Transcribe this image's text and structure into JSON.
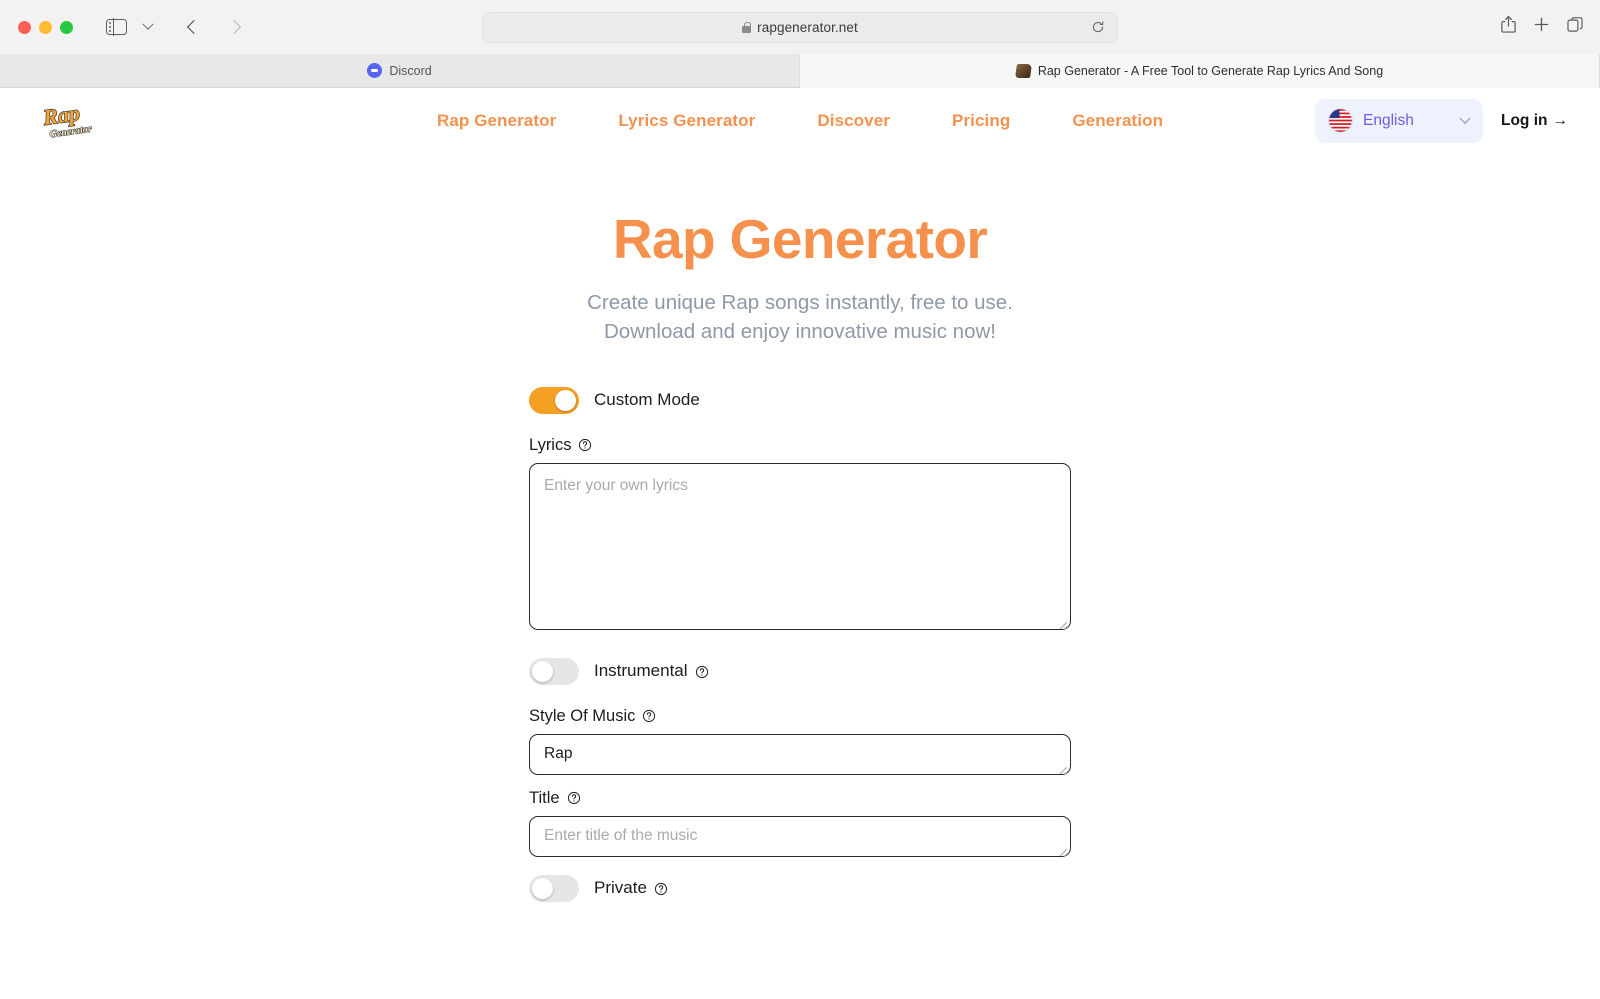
{
  "browser": {
    "url": "rapgenerator.net",
    "lock_icon": "lock-icon",
    "reload_icon": "reload-icon",
    "share_icon": "share-icon",
    "new_tab_icon": "plus-icon",
    "tab_overview_icon": "tab-overview-icon",
    "sidebar_icon": "sidebar-toggle-icon",
    "back_icon": "back-arrow-icon",
    "forward_icon": "forward-arrow-icon",
    "tabs": [
      {
        "title": "Discord",
        "favicon": "discord-icon",
        "active": false
      },
      {
        "title": "Rap Generator - A Free Tool to Generate Rap Lyrics And Song",
        "favicon": "rap-generator-icon",
        "active": true
      }
    ]
  },
  "header": {
    "logo_alt": "Rap Generator",
    "nav": [
      {
        "label": "Rap Generator"
      },
      {
        "label": "Lyrics Generator"
      },
      {
        "label": "Discover"
      },
      {
        "label": "Pricing"
      },
      {
        "label": "Generation"
      }
    ],
    "language": {
      "label": "English",
      "flag": "us-flag-icon",
      "chevron": "chevron-down-icon"
    },
    "login_label": "Log in",
    "login_arrow": "→"
  },
  "hero": {
    "title": "Rap Generator",
    "subtitle_line1": "Create unique Rap songs instantly, free to use.",
    "subtitle_line2": "Download and enjoy innovative music now!"
  },
  "form": {
    "custom_mode": {
      "label": "Custom Mode",
      "enabled": true
    },
    "lyrics": {
      "label": "Lyrics",
      "help_icon": "question-circle-icon",
      "placeholder": "Enter your own lyrics",
      "value": ""
    },
    "instrumental": {
      "label": "Instrumental",
      "enabled": false,
      "help_icon": "question-circle-icon"
    },
    "style_of_music": {
      "label": "Style Of Music",
      "help_icon": "question-circle-icon",
      "placeholder": "",
      "value": "Rap"
    },
    "title": {
      "label": "Title",
      "help_icon": "question-circle-icon",
      "placeholder": "Enter title of the music",
      "value": ""
    },
    "private": {
      "label": "Private",
      "enabled": false,
      "help_icon": "question-circle-icon"
    }
  },
  "colors": {
    "accent_orange": "#f5914c",
    "toggle_on": "#f4a024",
    "language_text": "#6b5ce7",
    "language_bg": "#eef2fd",
    "subtitle_gray": "#8e98a8"
  }
}
